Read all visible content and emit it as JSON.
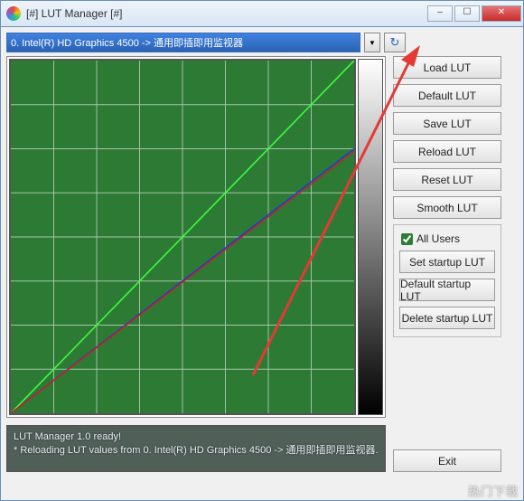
{
  "window": {
    "title": "[#] LUT Manager [#]"
  },
  "device_selector": "0. Intel(R) HD Graphics 4500  -> 通用即插即用监视器",
  "buttons": {
    "load": "Load LUT",
    "default": "Default LUT",
    "save": "Save LUT",
    "reload": "Reload LUT",
    "reset": "Reset LUT",
    "smooth": "Smooth LUT",
    "set_startup": "Set startup LUT",
    "default_startup": "Default startup LUT",
    "delete_startup": "Delete startup LUT",
    "exit": "Exit"
  },
  "checkbox": {
    "all_users": "All Users",
    "all_users_checked": true
  },
  "status": {
    "line1": "LUT Manager 1.0 ready!",
    "line2": "* Reloading LUT values from 0. Intel(R) HD Graphics 4500 -> 通用即插即用监视器."
  },
  "chart_data": {
    "type": "line",
    "xrange": [
      0,
      255
    ],
    "yrange": [
      0,
      255
    ],
    "grid_divisions": 8,
    "series": [
      {
        "name": "green-channel",
        "color": "#3dff3d",
        "points": [
          [
            0,
            0
          ],
          [
            255,
            255
          ]
        ]
      },
      {
        "name": "blue-channel",
        "color": "#1d3bd1",
        "points": [
          [
            0,
            0
          ],
          [
            255,
            192
          ]
        ]
      },
      {
        "name": "red-channel",
        "color": "#d81b1b",
        "points": [
          [
            0,
            0
          ],
          [
            255,
            190
          ]
        ]
      }
    ]
  },
  "watermark": "热门下载"
}
